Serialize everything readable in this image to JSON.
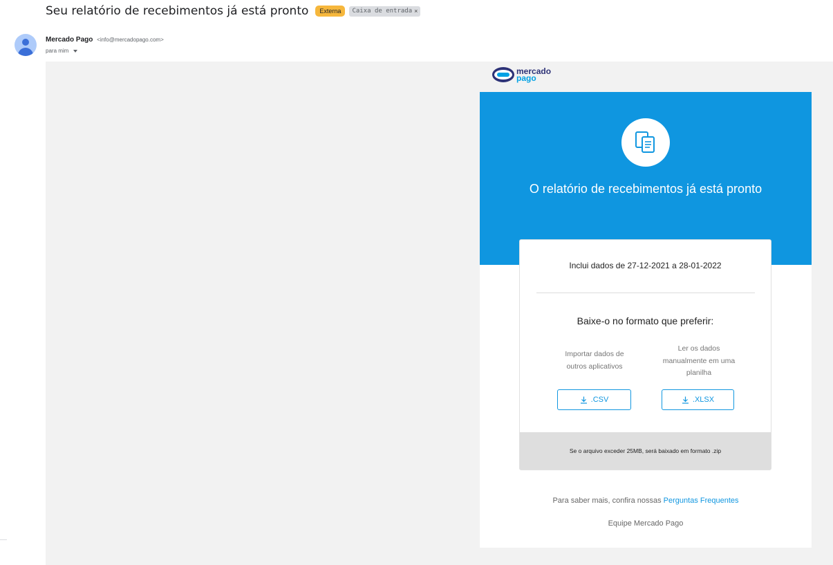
{
  "email": {
    "subject": "Seu relatório de recebimentos já está pronto",
    "labels": {
      "external": "Externa",
      "inbox": "Caixa de entrada",
      "inbox_remove": "×"
    },
    "sender_name": "Mercado Pago",
    "sender_email": "<info@mercadopago.com>",
    "recipient": "para mim"
  },
  "logo": {
    "line1": "mercado",
    "line2": "pago"
  },
  "hero": {
    "title": "O relatório de recebimentos já está pronto"
  },
  "report": {
    "range_text": "Inclui dados de 27-12-2021 a 28-01-2022",
    "choose_text": "Baixe-o no formato que preferir:",
    "option_csv": {
      "description": "Importar dados de outros aplicativos",
      "button": ".CSV"
    },
    "option_xlsx": {
      "description": "Ler os dados manualmente em uma planilha",
      "button": ".XLSX"
    },
    "note": "Se o arquivo exceder 25MB, será baixado em formato .zip"
  },
  "footer": {
    "more_prefix": "Para saber mais, confira nossas",
    "faq_link": "Perguntas Frequentes",
    "signature": "Equipe Mercado Pago"
  },
  "icons": {
    "avatar": "person-avatar-icon",
    "caret": "caret-down-icon",
    "document": "documents-icon",
    "download": "download-icon",
    "logo": "mercado-pago-handshake-logo"
  },
  "colors": {
    "accent": "#0f96e0",
    "external_label": "#f6b73c",
    "brand_dark": "#2d3277"
  }
}
